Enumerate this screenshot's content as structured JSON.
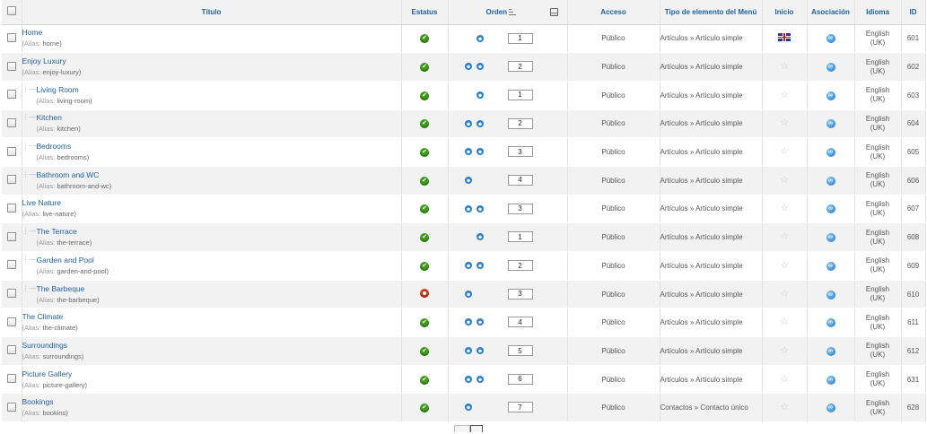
{
  "header": {
    "title": "Título",
    "status": "Estatus",
    "order": "Orden",
    "access": "Acceso",
    "type": "Tipo de elemento del Menú",
    "home": "Inicio",
    "association": "Asociación",
    "language": "Idioma",
    "id": "ID"
  },
  "alias_label": "(Alias:",
  "alias_close": ")",
  "colors": {
    "link": "#1e5f9c",
    "published": "#3f9a1b",
    "unpublished": "#d13b16",
    "row_alt": "#f2f2f2"
  },
  "icons": {
    "published": "check-icon",
    "unpublished": "unpublished-icon",
    "order_up": "arrow-up-icon",
    "order_down": "arrow-down-icon",
    "not_home": "star-icon",
    "home": "uk-flag-icon",
    "association": "association-icon"
  },
  "rows": [
    {
      "title": "Home",
      "alias": "home",
      "level": 0,
      "status": "published",
      "up": false,
      "down": true,
      "order": "1",
      "access": "Público",
      "type": "Artículos » Artículo simple",
      "home": true,
      "lang": [
        "English",
        "(UK)"
      ],
      "id": "601"
    },
    {
      "title": "Enjoy Luxury",
      "alias": "enjoy-luxury",
      "level": 0,
      "status": "published",
      "up": true,
      "down": true,
      "order": "2",
      "access": "Público",
      "type": "Artículos » Artículo simple",
      "home": false,
      "lang": [
        "English",
        "(UK)"
      ],
      "id": "602"
    },
    {
      "title": "Living Room",
      "alias": "living-room",
      "level": 1,
      "status": "published",
      "up": false,
      "down": true,
      "order": "1",
      "access": "Público",
      "type": "Artículos » Artículo simple",
      "home": false,
      "lang": [
        "English",
        "(UK)"
      ],
      "id": "603"
    },
    {
      "title": "Kitchen",
      "alias": "kitchen",
      "level": 1,
      "status": "published",
      "up": true,
      "down": true,
      "order": "2",
      "access": "Público",
      "type": "Artículos » Artículo simple",
      "home": false,
      "lang": [
        "English",
        "(UK)"
      ],
      "id": "604"
    },
    {
      "title": "Bedrooms",
      "alias": "bedrooms",
      "level": 1,
      "status": "published",
      "up": true,
      "down": true,
      "order": "3",
      "access": "Público",
      "type": "Artículos » Artículo simple",
      "home": false,
      "lang": [
        "English",
        "(UK)"
      ],
      "id": "605"
    },
    {
      "title": "Bathroom and WC",
      "alias": "bathroom-and-wc",
      "level": 1,
      "status": "published",
      "up": true,
      "down": false,
      "order": "4",
      "access": "Público",
      "type": "Artículos » Artículo simple",
      "home": false,
      "lang": [
        "English",
        "(UK)"
      ],
      "id": "606"
    },
    {
      "title": "Live Nature",
      "alias": "live-nature",
      "level": 0,
      "status": "published",
      "up": true,
      "down": true,
      "order": "3",
      "access": "Público",
      "type": "Artículos » Artículo simple",
      "home": false,
      "lang": [
        "English",
        "(UK)"
      ],
      "id": "607"
    },
    {
      "title": "The Terrace",
      "alias": "the-terrace",
      "level": 1,
      "status": "published",
      "up": false,
      "down": true,
      "order": "1",
      "access": "Público",
      "type": "Artículos » Artículo simple",
      "home": false,
      "lang": [
        "English",
        "(UK)"
      ],
      "id": "608"
    },
    {
      "title": "Garden and Pool",
      "alias": "garden-and-pool",
      "level": 1,
      "status": "published",
      "up": true,
      "down": true,
      "order": "2",
      "access": "Público",
      "type": "Artículos » Artículo simple",
      "home": false,
      "lang": [
        "English",
        "(UK)"
      ],
      "id": "609"
    },
    {
      "title": "The Barbeque",
      "alias": "the-barbeque",
      "level": 1,
      "status": "unpublished",
      "up": true,
      "down": false,
      "order": "3",
      "access": "Público",
      "type": "Artículos » Artículo simple",
      "home": false,
      "lang": [
        "English",
        "(UK)"
      ],
      "id": "610"
    },
    {
      "title": "The Climate",
      "alias": "the-climate",
      "level": 0,
      "status": "published",
      "up": true,
      "down": true,
      "order": "4",
      "access": "Público",
      "type": "Artículos » Artículo simple",
      "home": false,
      "lang": [
        "English",
        "(UK)"
      ],
      "id": "611"
    },
    {
      "title": "Surroundings",
      "alias": "surroundings",
      "level": 0,
      "status": "published",
      "up": true,
      "down": true,
      "order": "5",
      "access": "Público",
      "type": "Artículos » Artículo simple",
      "home": false,
      "lang": [
        "English",
        "(UK)"
      ],
      "id": "612"
    },
    {
      "title": "Picture Gallery",
      "alias": "picture-gallery",
      "level": 0,
      "status": "published",
      "up": true,
      "down": true,
      "order": "6",
      "access": "Público",
      "type": "Artículos » Artículo simple",
      "home": false,
      "lang": [
        "English",
        "(UK)"
      ],
      "id": "631"
    },
    {
      "title": "Bookings",
      "alias": "bookins",
      "level": 0,
      "status": "published",
      "up": true,
      "down": false,
      "order": "7",
      "access": "Público",
      "type": "Contactos » Contacto único",
      "home": false,
      "lang": [
        "English",
        "(UK)"
      ],
      "id": "628"
    }
  ]
}
